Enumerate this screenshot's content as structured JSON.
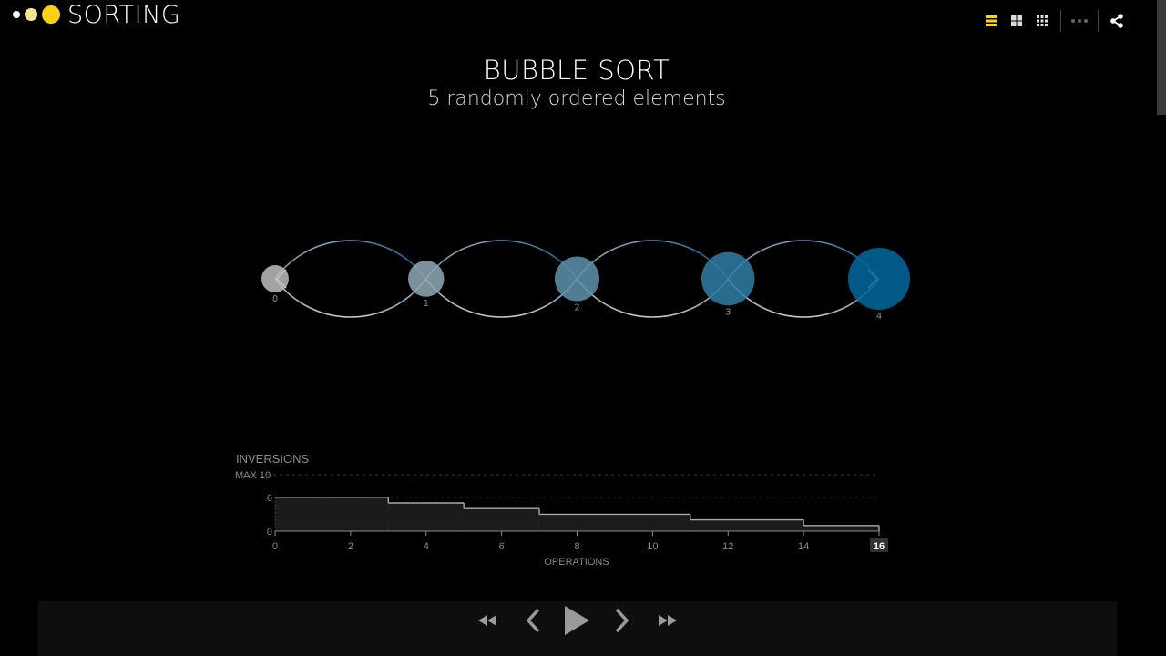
{
  "app": {
    "title": "SORTING"
  },
  "heading": {
    "title": "BUBBLE SORT",
    "subtitle": "5 randomly ordered elements"
  },
  "toolbar": {
    "icons": [
      "list-view-icon",
      "grid-view-icon",
      "small-grid-view-icon",
      "more-icon",
      "share-icon"
    ],
    "accent": "#fcd116"
  },
  "elements": [
    {
      "label": "0",
      "value": 0
    },
    {
      "label": "1",
      "value": 1
    },
    {
      "label": "2",
      "value": 2
    },
    {
      "label": "3",
      "value": 3
    },
    {
      "label": "4",
      "value": 4
    }
  ],
  "chart_data": {
    "type": "line",
    "title": "INVERSIONS",
    "xlabel": "OPERATIONS",
    "max_label": "MAX 10",
    "ymax": 10,
    "yticks": [
      0,
      6
    ],
    "xticks": [
      0,
      2,
      4,
      6,
      8,
      10,
      12,
      14,
      16
    ],
    "xlim": [
      0,
      16
    ],
    "ylim": [
      0,
      10
    ],
    "current_x": 16,
    "current_label": "16",
    "steps": [
      {
        "x0": 0,
        "x1": 3,
        "y": 6
      },
      {
        "x0": 3,
        "x1": 5,
        "y": 5
      },
      {
        "x0": 5,
        "x1": 7,
        "y": 4
      },
      {
        "x0": 7,
        "x1": 11,
        "y": 3
      },
      {
        "x0": 11,
        "x1": 14,
        "y": 2
      },
      {
        "x0": 14,
        "x1": 16,
        "y": 1
      }
    ]
  },
  "player": {
    "buttons": [
      "rewind-icon",
      "step-back-icon",
      "play-icon",
      "step-forward-icon",
      "fast-forward-icon"
    ]
  }
}
